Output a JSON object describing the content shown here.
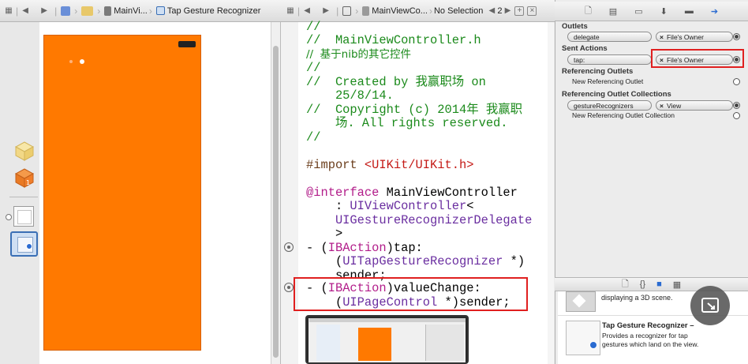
{
  "jumpbar_left": {
    "crumb1": "MainVi...",
    "crumb2": "Tap Gesture Recognizer"
  },
  "jumpbar_mid": {
    "file": "MainViewCo...",
    "selection": "No Selection",
    "counter": "2"
  },
  "code": {
    "l1": "//",
    "l2": "//  MainViewController.h",
    "l3": "//  基于nib的其它控件",
    "l4": "//",
    "l5a": "//  Created by 我赢职场 on",
    "l5b": "    25/8/14.",
    "l6a": "//  Copyright (c) 2014年 我赢职",
    "l6b": "    场. All rights reserved.",
    "l7": "//",
    "import_kw": "#import ",
    "import_path": "<UIKit/UIKit.h>",
    "iface_kw": "@interface",
    "iface_name": " MainViewController",
    "iface_l2a": "    : ",
    "iface_l2b": "UIViewController",
    "iface_l2c": "<",
    "iface_l3": "    UIGestureRecognizerDelegate",
    "iface_l4": "    >",
    "tap_a": "- (",
    "tap_b": "IBAction",
    "tap_c": ")tap:",
    "tap_l2a": "    (",
    "tap_l2b": "UITapGestureRecognizer",
    "tap_l2c": " *)",
    "tap_l3": "    sender;",
    "vc_a": "- (",
    "vc_b": "IBAction",
    "vc_c": ")valueChange:",
    "vc_l2a": "    (",
    "vc_l2b": "UIPageControl",
    "vc_l2c": " *)sender;"
  },
  "inspector": {
    "outlets_title": "Outlets",
    "outlet_name": "delegate",
    "outlet_target": "File's Owner",
    "sent_title": "Sent Actions",
    "sent_name": "tap:",
    "sent_target": "File's Owner",
    "ref_title": "Referencing Outlets",
    "ref_new": "New Referencing Outlet",
    "refcol_title": "Referencing Outlet Collections",
    "refcol_name": "gestureRecognizers",
    "refcol_target": "View",
    "refcol_new": "New Referencing Outlet Collection"
  },
  "library": {
    "item1_desc": "displaying a 3D scene.",
    "item2_title": "Tap Gesture Recognizer",
    "item2_desc1": "Provides a recognizer for tap",
    "item2_desc2": "gestures which land on the view."
  },
  "colors": {
    "view_background": "#ff7900",
    "highlight_box": "#e02020",
    "comment": "#1b8a1b",
    "keyword": "#b21d8a"
  }
}
